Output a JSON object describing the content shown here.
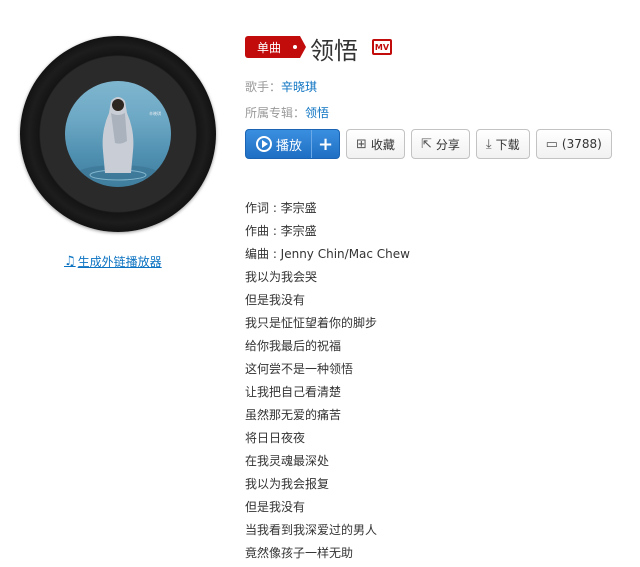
{
  "song": {
    "tag": "单曲",
    "title": "领悟",
    "mv_label": "MV",
    "singer_label": "歌手：",
    "singer": "辛晓琪",
    "album_label": "所属专辑：",
    "album": "领悟"
  },
  "player_link": "生成外链播放器",
  "buttons": {
    "play": "播放",
    "plus": "+",
    "collect": "收藏",
    "share": "分享",
    "download": "下载",
    "comments": "(3788)"
  },
  "lyrics": [
    "作词 : 李宗盛",
    "作曲 : 李宗盛",
    "编曲 : Jenny Chin/Mac Chew",
    "我以为我会哭",
    "但是我没有",
    "我只是怔怔望着你的脚步",
    "给你我最后的祝福",
    "这何尝不是一种领悟",
    "让我把自己看清楚",
    "虽然那无爱的痛苦",
    "将日日夜夜",
    "在我灵魂最深处",
    "我以为我会报复",
    "但是我没有",
    "当我看到我深爱过的男人",
    "竟然像孩子一样无助"
  ],
  "icons": {
    "note": "music-note-icon",
    "collect": "add-folder-icon",
    "share": "share-icon",
    "download": "download-icon",
    "comment": "comment-icon"
  },
  "colors": {
    "accent_red": "#c20c0c",
    "link_blue": "#0c73c2",
    "play_blue": "#2b7fd4"
  }
}
